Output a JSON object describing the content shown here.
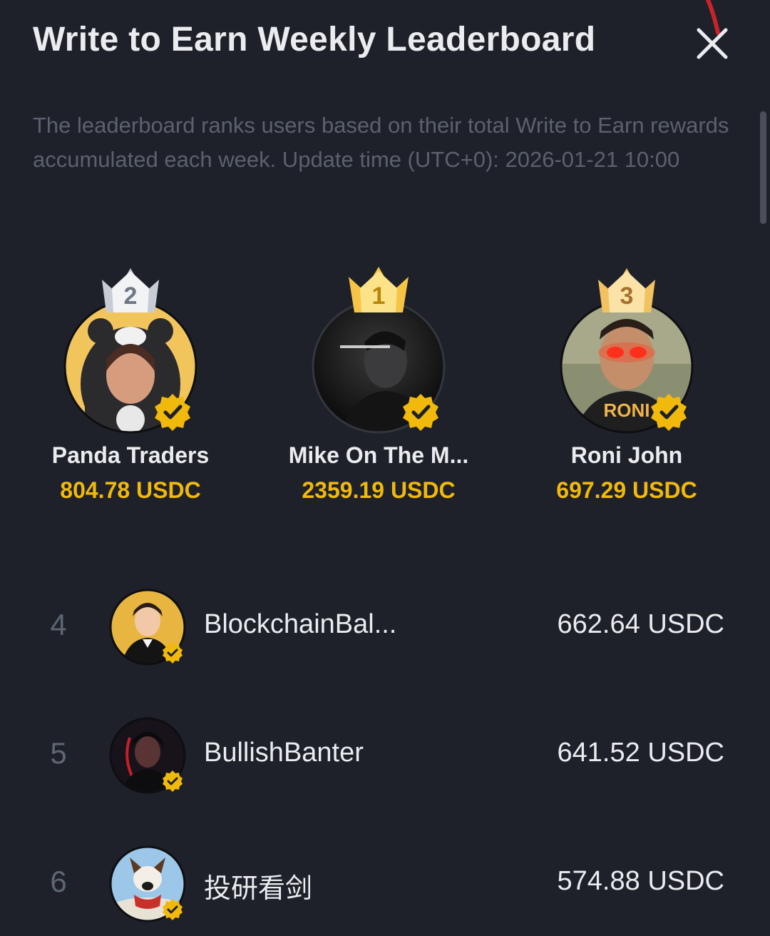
{
  "header": {
    "title": "Write to Earn Weekly Leaderboard",
    "close_icon": "close-icon"
  },
  "description": "The leaderboard ranks users based on their total Write to Earn rewards accumulated each week. Update time (UTC+0): 2026-01-21 10:00",
  "colors": {
    "background": "#1e2129",
    "accent_gold": "#f0b90b",
    "text_primary": "#eaecef",
    "text_muted": "#5b616e",
    "crown_gold": "#f6c445",
    "crown_silver": "#c7ccd4",
    "crown_bronze": "#f2c160"
  },
  "podium": [
    {
      "rank": "2",
      "name": "Panda Traders",
      "amount": "804.78 USDC",
      "verified": true
    },
    {
      "rank": "1",
      "name": "Mike On The M...",
      "amount": "2359.19 USDC",
      "verified": true
    },
    {
      "rank": "3",
      "name": "Roni John",
      "amount": "697.29 USDC",
      "verified": true,
      "avatar_text": "RONI"
    }
  ],
  "list": [
    {
      "rank": "4",
      "name": "BlockchainBal...",
      "amount": "662.64 USDC",
      "verified": true
    },
    {
      "rank": "5",
      "name": "BullishBanter",
      "amount": "641.52 USDC",
      "verified": true
    },
    {
      "rank": "6",
      "name": "投研看剑",
      "amount": "574.88 USDC",
      "verified": true
    }
  ]
}
